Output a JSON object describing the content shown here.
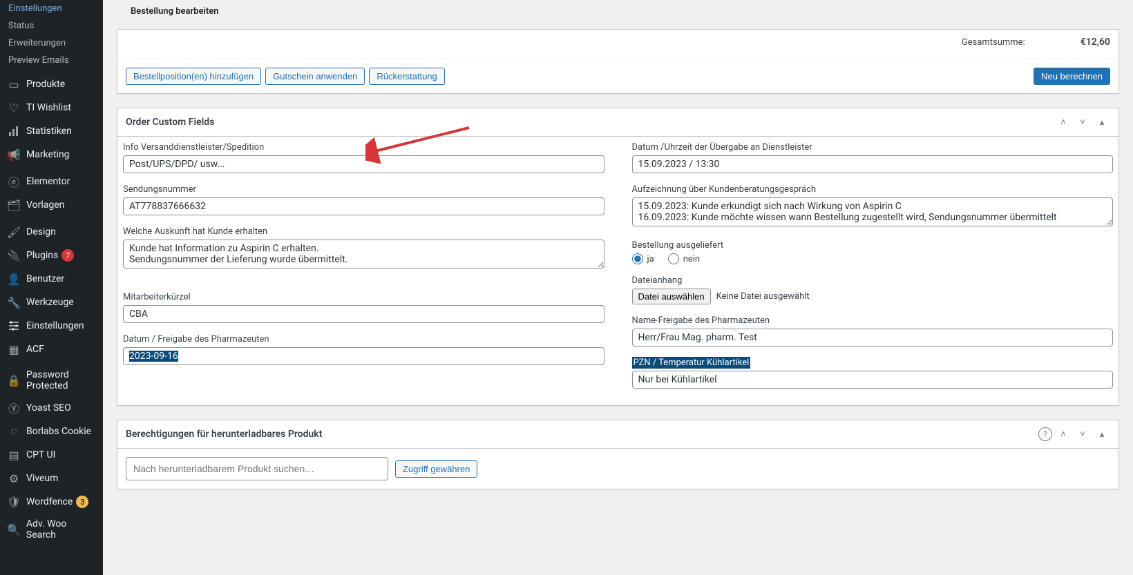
{
  "page_title": "Bestellung bearbeiten",
  "sidebar": {
    "sub_items": [
      "Einstellungen",
      "Status",
      "Erweiterungen",
      "Preview Emails"
    ],
    "items": [
      {
        "label": "Produkte",
        "icon": "archive"
      },
      {
        "label": "TI Wishlist",
        "icon": "heart"
      },
      {
        "label": "Statistiken",
        "icon": "stats"
      },
      {
        "label": "Marketing",
        "icon": "megaphone"
      }
    ],
    "items2": [
      {
        "label": "Elementor",
        "icon": "elementor"
      },
      {
        "label": "Vorlagen",
        "icon": "templates"
      }
    ],
    "items3": [
      {
        "label": "Design",
        "icon": "brush"
      },
      {
        "label": "Plugins",
        "icon": "plug",
        "badge": "7"
      },
      {
        "label": "Benutzer",
        "icon": "user"
      },
      {
        "label": "Werkzeuge",
        "icon": "wrench"
      },
      {
        "label": "Einstellungen",
        "icon": "sliders"
      },
      {
        "label": "ACF",
        "icon": "acf"
      }
    ],
    "items4": [
      {
        "label": "Password Protected",
        "icon": "lock"
      },
      {
        "label": "Yoast SEO",
        "icon": "yoast"
      },
      {
        "label": "Borlabs Cookie",
        "icon": "cookie"
      },
      {
        "label": "CPT UI",
        "icon": "cpt"
      },
      {
        "label": "Viveum",
        "icon": "gear"
      },
      {
        "label": "Wordfence",
        "icon": "wordfence",
        "badge": "3",
        "badge_class": "orange"
      },
      {
        "label": "Adv. Woo Search",
        "icon": "search"
      }
    ]
  },
  "totals": {
    "label": "Gesamtsumme:",
    "value": "€12,60"
  },
  "order_actions": {
    "add_items": "Bestellposition(en) hinzufügen",
    "apply_coupon": "Gutschein anwenden",
    "refund": "Rückerstattung",
    "recalc": "Neu berechnen"
  },
  "custom_fields": {
    "panel_title": "Order Custom Fields",
    "left": {
      "info_label": "Info Versanddienstleister/Spedition",
      "info_value": "Post/UPS/DPD/ usw...",
      "tracking_label": "Sendungsnummer",
      "tracking_value": "AT778837666632",
      "auskunft_label": "Welche Auskunft hat Kunde erhalten",
      "auskunft_value": "Kunde hat Information zu Aspirin C erhalten.\nSendungsnummer der Lieferung wurde übermittelt.",
      "kuerzel_label": "Mitarbeiterkürzel",
      "kuerzel_value": "CBA",
      "datum_label": "Datum / Freigabe des Pharmazeuten",
      "datum_value": "2023-09-16"
    },
    "right": {
      "handover_label": "Datum /Uhrzeit der Übergabe an Dienstleister",
      "handover_value": "15.09.2023 / 13:30",
      "beratung_label": "Aufzeichnung über Kundenberatungsgespräch",
      "beratung_value": "15.09.2023: Kunde erkundigt sich nach Wirkung von Aspirin C\n16.09.2023: Kunde möchte wissen wann Bestellung zugestellt wird, Sendungsnummer übermittelt",
      "delivered_label": "Bestellung ausgeliefert",
      "delivered_yes": "ja",
      "delivered_no": "nein",
      "file_label": "Dateianhang",
      "file_button": "Datei auswählen",
      "file_none": "Keine Datei ausgewählt",
      "pharma_label": "Name-Freigabe des Pharmazeuten",
      "pharma_value": "Herr/Frau Mag. pharm. Test",
      "pzn_label": "PZN / Temperatur Kühlartikel",
      "pzn_value": "Nur bei Kühlartikel"
    }
  },
  "downloads": {
    "panel_title": "Berechtigungen für herunterladbares Produkt",
    "search_placeholder": "Nach herunterladbarem Produkt suchen…",
    "grant": "Zugriff gewähren"
  }
}
